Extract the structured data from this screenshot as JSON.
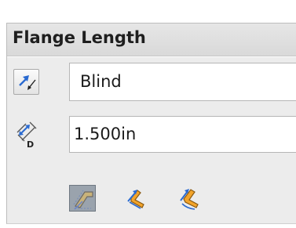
{
  "panel": {
    "title": "Flange Length"
  },
  "end_condition": {
    "selected": "Blind",
    "direction_icon": "reverse-direction-icon"
  },
  "length": {
    "value": "1.500in",
    "icon": "distance-icon"
  },
  "flange_position_options": [
    {
      "icon": "outer-virtual-sharp-icon",
      "selected": true
    },
    {
      "icon": "inner-virtual-sharp-icon",
      "selected": false
    },
    {
      "icon": "tangent-bend-icon",
      "selected": false
    }
  ],
  "colors": {
    "panel_bg": "#ececec",
    "header_bg": "#dcdcdc",
    "accent_blue": "#2f6fd1",
    "accent_orange": "#f0a020"
  }
}
